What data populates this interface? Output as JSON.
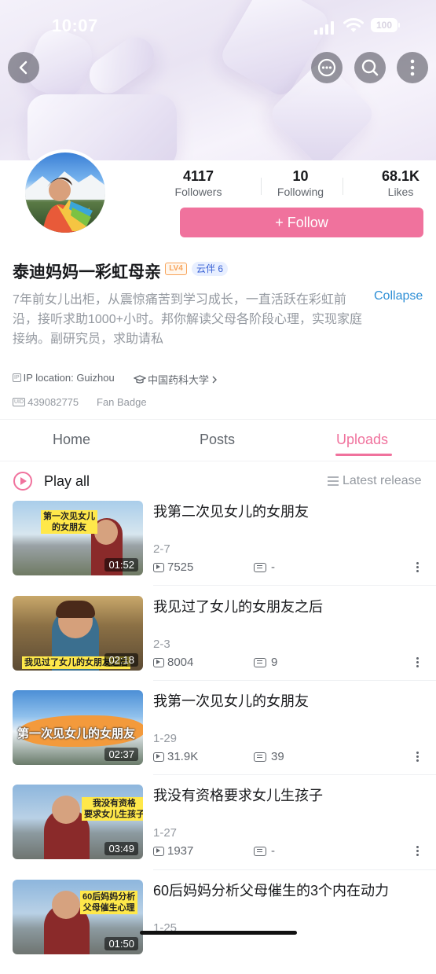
{
  "status_bar": {
    "time": "10:07",
    "battery": "100"
  },
  "profile": {
    "name": "泰迪妈妈一彩虹母亲",
    "level_badge": "LV4",
    "tag": "云伴 6",
    "stats": [
      {
        "value": "4117",
        "label": "Followers"
      },
      {
        "value": "10",
        "label": "Following"
      },
      {
        "value": "68.1K",
        "label": "Likes"
      }
    ],
    "follow_label": "+ Follow",
    "bio": "7年前女儿出柜，从震惊痛苦到学习成长，一直活跃在彩虹前沿，接听求助1000+小时。邦你解读父母各阶段心理，实现家庭接纳。副研究员，求助请私",
    "collapse_label": "Collapse",
    "ip_location": "IP location: Guizhou",
    "school": "中国药科大学",
    "uid": "439082775",
    "fan_badge": "Fan Badge"
  },
  "tabs": {
    "home": "Home",
    "posts": "Posts",
    "uploads": "Uploads"
  },
  "list_header": {
    "play_all": "Play all",
    "sort": "Latest release"
  },
  "videos": [
    {
      "title": "我第二次见女儿的女朋友",
      "date": "2-7",
      "views": "7525",
      "comments": "-",
      "duration": "01:52",
      "caption": "第一次见女儿\n的女朋友"
    },
    {
      "title": "我见过了女儿的女朋友之后",
      "date": "2-3",
      "views": "8004",
      "comments": "9",
      "duration": "02:18",
      "caption": "我见过了女儿的女朋友之后"
    },
    {
      "title": "我第一次见女儿的女朋友",
      "date": "1-29",
      "views": "31.9K",
      "comments": "39",
      "duration": "02:37",
      "caption": "第一次见女儿的女朋友"
    },
    {
      "title": "我没有资格要求女儿生孩子",
      "date": "1-27",
      "views": "1937",
      "comments": "-",
      "duration": "03:49",
      "caption": "我没有资格\n要求女儿生孩子"
    },
    {
      "title": "60后妈妈分析父母催生的3个内在动力",
      "date": "1-25",
      "views": "",
      "comments": "",
      "duration": "01:50",
      "caption": "60后妈妈分析\n父母催生心理"
    }
  ],
  "colors": {
    "accent": "#f0729d",
    "link": "#2e8fd6"
  }
}
